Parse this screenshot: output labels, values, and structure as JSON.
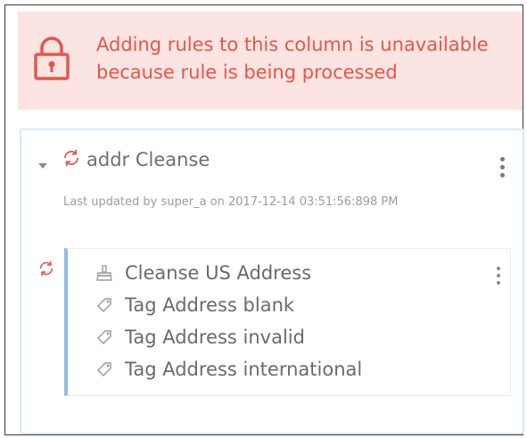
{
  "banner": {
    "message": "Adding rules to this column is unavailable because rule is being processed",
    "icon": "lock-icon",
    "color": "#e2574c",
    "background": "#fbe4e1"
  },
  "rule": {
    "name": "addr Cleanse",
    "last_updated": "Last updated by super_a on 2017-12-14 03:51:56:898 PM",
    "status_icon": "sync-icon",
    "subrules": [
      {
        "label": "Cleanse US Address",
        "icon": "cleanse-icon"
      },
      {
        "label": "Tag Address blank",
        "icon": "tag-icon"
      },
      {
        "label": "Tag Address invalid",
        "icon": "tag-icon"
      },
      {
        "label": "Tag Address international",
        "icon": "tag-icon"
      }
    ]
  }
}
